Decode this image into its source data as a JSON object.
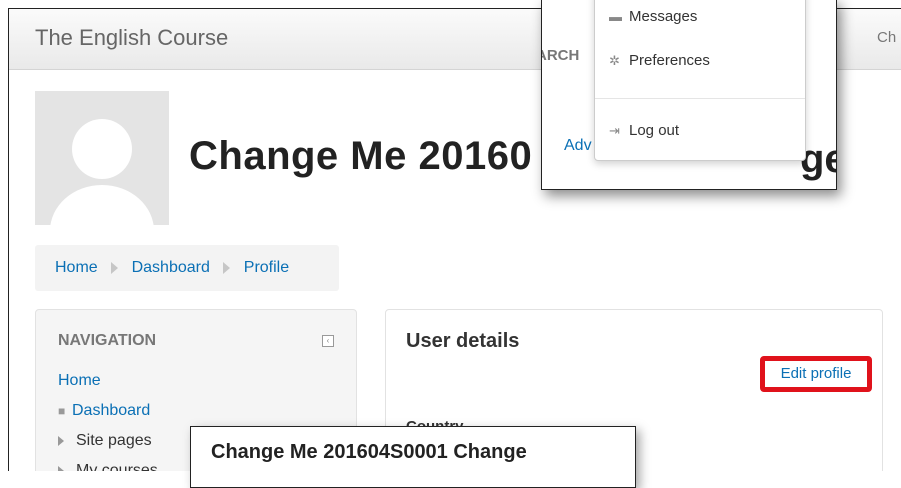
{
  "header": {
    "site_name": "The English Course",
    "right_fragment": "Ch",
    "search_fragment": "ARCH"
  },
  "profile": {
    "title": "Change Me 20160"
  },
  "breadcrumb": {
    "items": [
      "Home",
      "Dashboard",
      "Profile"
    ]
  },
  "navigation": {
    "title": "NAVIGATION",
    "home": "Home",
    "items": [
      "Dashboard",
      "Site pages",
      "My courses"
    ]
  },
  "user_details": {
    "title": "User details",
    "edit_label": "Edit profile",
    "country_label": "Country"
  },
  "user_menu": {
    "items": [
      "Messages",
      "Preferences",
      "Log out"
    ],
    "advanced_fragment": "Adv",
    "title_fragment_right": "ge M"
  },
  "callout": {
    "text": "Change Me 201604S0001 Change"
  }
}
